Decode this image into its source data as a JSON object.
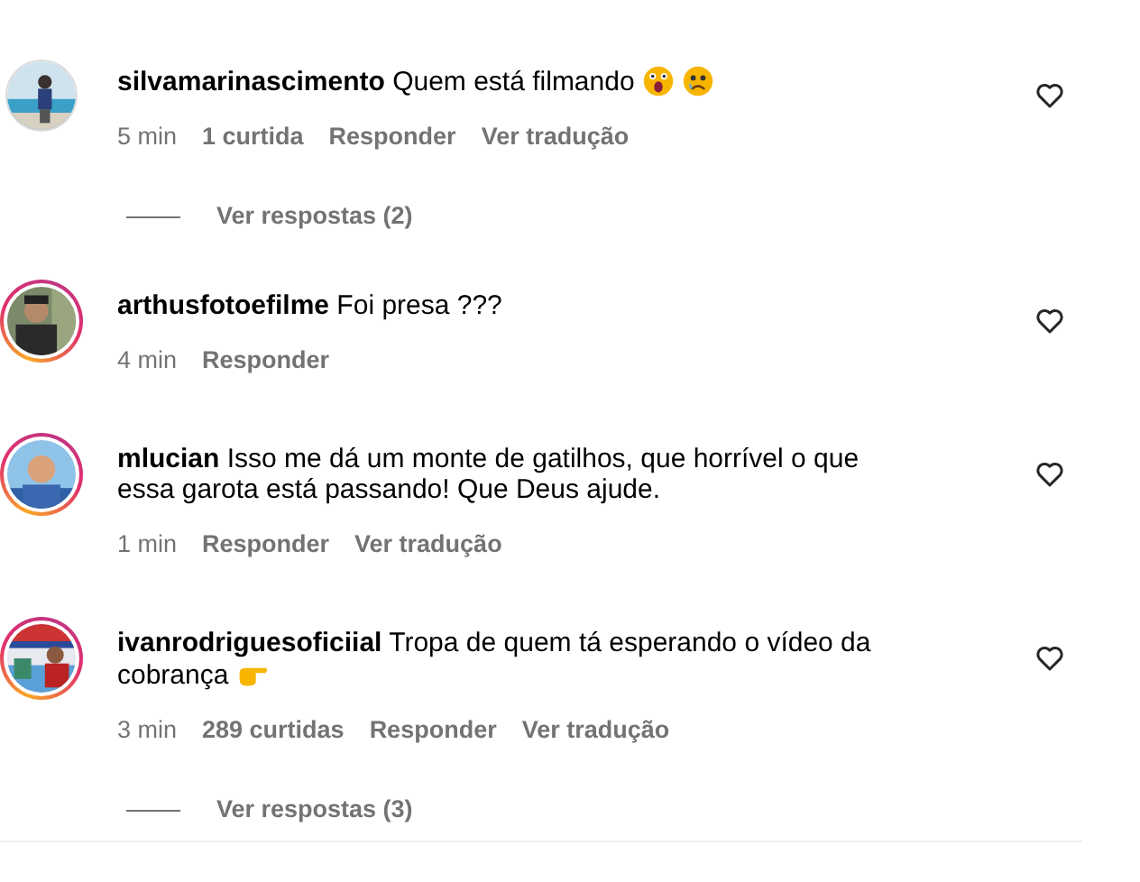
{
  "comments": [
    {
      "kind": "comment",
      "story_ring": false,
      "username": "silvamarinascimento",
      "text": "Quem está filmando",
      "emojis": [
        {
          "kind": "shocked"
        },
        {
          "kind": "sad"
        }
      ],
      "time": "5 min",
      "likes": "1 curtida",
      "reply": "Responder",
      "translate": "Ver tradução"
    },
    {
      "kind": "replies",
      "label": "Ver respostas (2)"
    },
    {
      "kind": "comment",
      "story_ring": true,
      "username": "arthusfotoefilme",
      "text": "Foi presa ???",
      "time": "4 min",
      "reply": "Responder"
    },
    {
      "kind": "comment",
      "story_ring": true,
      "username": "mlucian",
      "text": "Isso me dá um monte de gatilhos, que horrível o que essa garota está passando! Que Deus ajude.",
      "time": "1 min",
      "reply": "Responder",
      "translate": "Ver tradução"
    },
    {
      "kind": "comment",
      "story_ring": true,
      "username": "ivanrodriguesoficiial",
      "text": "Tropa de quem tá esperando o vídeo da cobrança",
      "emojis": [
        {
          "kind": "pointing"
        }
      ],
      "time": "3 min",
      "likes": "289 curtidas",
      "reply": "Responder",
      "translate": "Ver tradução"
    },
    {
      "kind": "replies",
      "label": "Ver respostas (3)"
    }
  ]
}
